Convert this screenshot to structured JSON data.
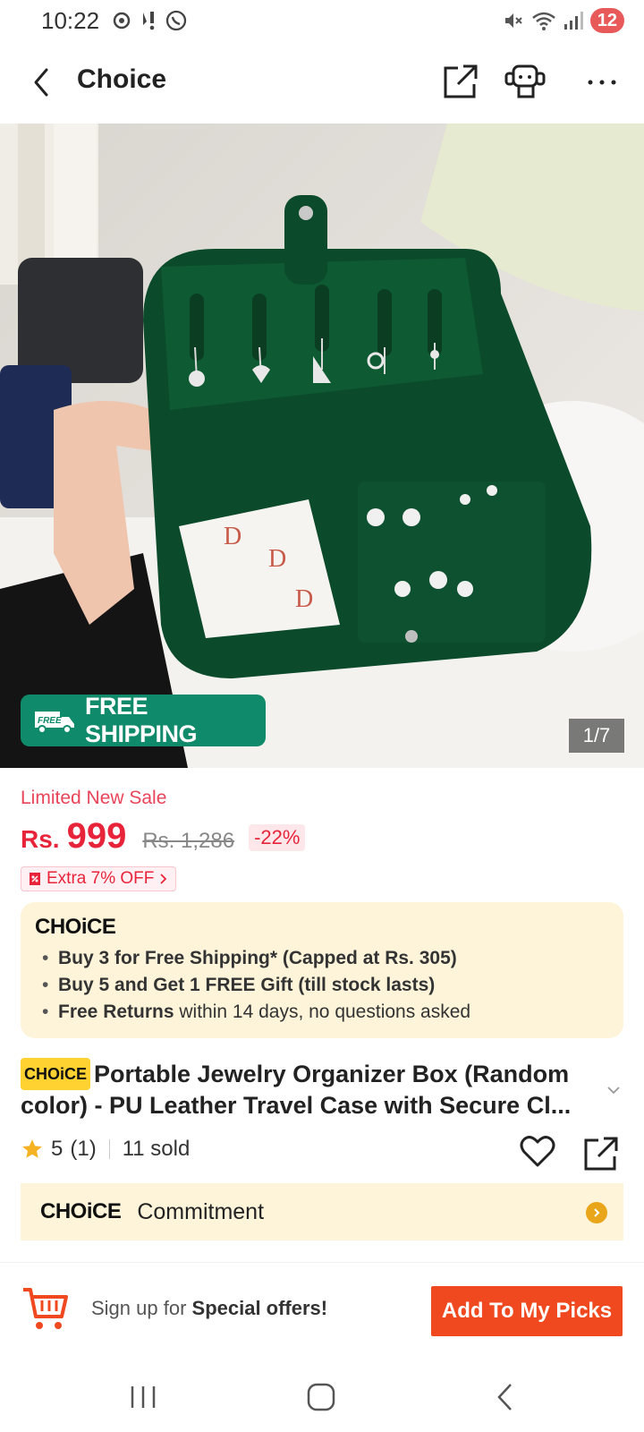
{
  "status": {
    "time": "10:22",
    "battery": "12",
    "left_icons": [
      "sync-icon",
      "notification-icon",
      "whatsapp-icon"
    ],
    "right_icons": [
      "mute-icon",
      "wifi-icon",
      "signal-icon"
    ]
  },
  "header": {
    "title": "Choice",
    "icons": [
      "share-icon",
      "support-icon",
      "more-icon"
    ]
  },
  "gallery": {
    "counter": "1/7",
    "badge_label": "FREE SHIPPING",
    "badge_small": "FREE"
  },
  "price": {
    "sale_label": "Limited New Sale",
    "currency": "Rs.",
    "current": "999",
    "original": "Rs. 1,286",
    "discount": "-22%",
    "coupon": "Extra 7% OFF"
  },
  "choice_box": {
    "logo": "CHOiCE",
    "bullets": [
      {
        "bold": "Buy 3 for  Free Shipping* (Capped at Rs. 305)",
        "rest": ""
      },
      {
        "bold": "Buy 5 and Get 1 FREE Gift (till stock lasts)",
        "rest": ""
      },
      {
        "bold": "Free Returns",
        "rest": " within 14 days, no questions asked"
      }
    ]
  },
  "product": {
    "chip": "CHOiCE",
    "title": "Portable Jewelry Organizer Box (Random color) - PU Leather Travel Case with Secure Cl...",
    "rating": "5",
    "reviews": "(1)",
    "sold": "11 sold"
  },
  "commitment": {
    "logo": "CHOiCE",
    "label": "Commitment"
  },
  "bottom": {
    "signup_prefix": "Sign up for ",
    "signup_bold": "Special offers!",
    "cta": "Add To My Picks"
  },
  "colors": {
    "price_red": "#e8243a",
    "cta_orange": "#f0491f",
    "choice_bg": "#fdf4d9",
    "free_ship_green": "#0f8a6a"
  }
}
